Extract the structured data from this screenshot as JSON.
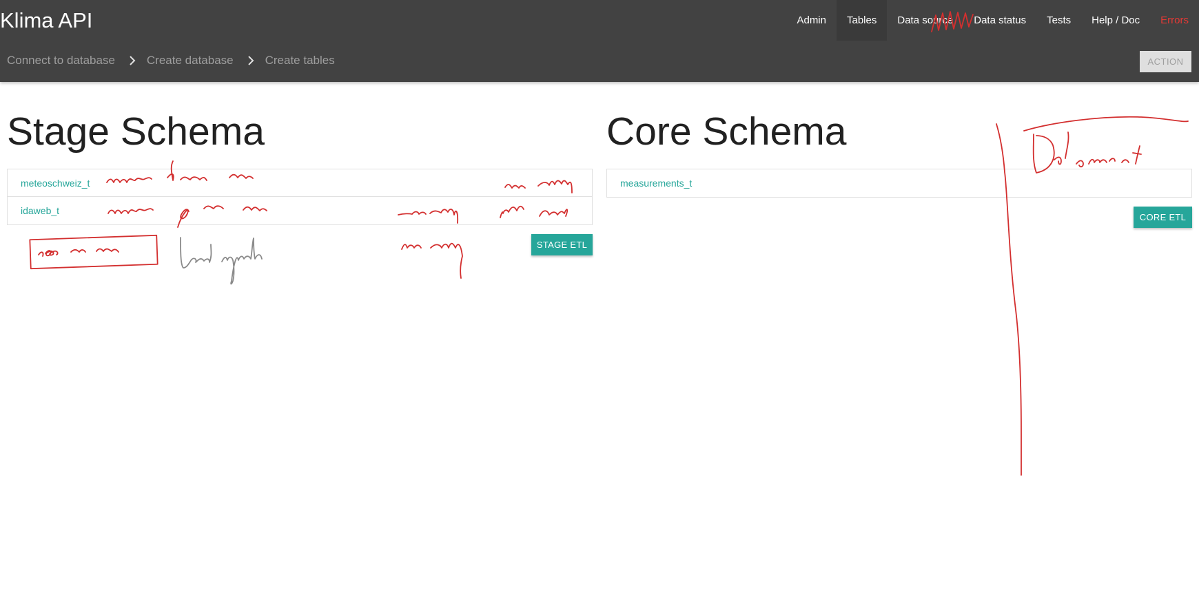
{
  "app": {
    "title": "Klima API"
  },
  "nav": {
    "items": [
      "Admin",
      "Tables",
      "Data source",
      "Data status",
      "Tests",
      "Help / Doc",
      "Errors"
    ]
  },
  "breadcrumb": [
    "Connect to database",
    "Create database",
    "Create tables"
  ],
  "toolbar": {
    "action_label": "ACTION"
  },
  "stage": {
    "title": "Stage Schema",
    "tables": [
      "meteoschweiz_t",
      "idaweb_t"
    ],
    "etl_label": "STAGE ETL"
  },
  "core": {
    "title": "Core Schema",
    "tables": [
      "measurements_t"
    ],
    "etl_label": "CORE ETL"
  },
  "colors": {
    "header": "#424242",
    "accent": "#26a69a",
    "error": "#e53935",
    "ink": "#d32f2f"
  }
}
